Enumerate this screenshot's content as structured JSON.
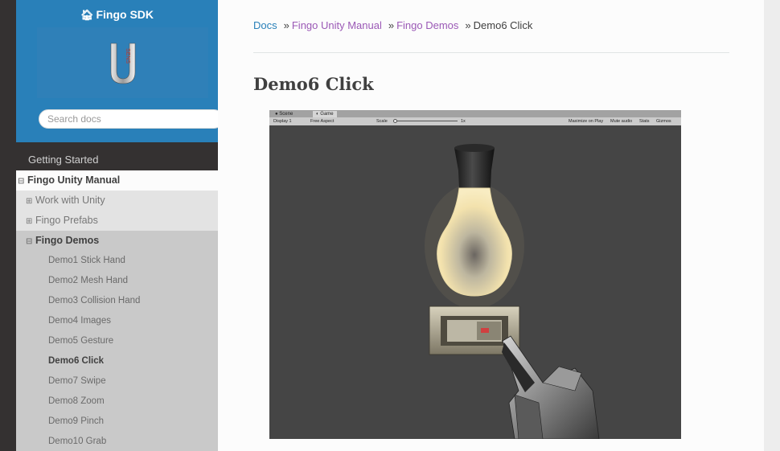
{
  "sidebar": {
    "brand": "Fingo SDK",
    "home_icon": "home-icon",
    "search_placeholder": "Search docs",
    "caption": "Getting Started",
    "items": [
      {
        "label": "Fingo Unity Manual",
        "toggle": "⊟"
      },
      {
        "label": "Work with Unity",
        "toggle": "⊞"
      },
      {
        "label": "Fingo Prefabs",
        "toggle": "⊞"
      },
      {
        "label": "Fingo Demos",
        "toggle": "⊟"
      },
      {
        "label": "Demo1 Stick Hand"
      },
      {
        "label": "Demo2 Mesh Hand"
      },
      {
        "label": "Demo3 Collision Hand"
      },
      {
        "label": "Demo4 Images"
      },
      {
        "label": "Demo5 Gesture"
      },
      {
        "label": "Demo6 Click"
      },
      {
        "label": "Demo7 Swipe"
      },
      {
        "label": "Demo8 Zoom"
      },
      {
        "label": "Demo9 Pinch"
      },
      {
        "label": "Demo10 Grab"
      }
    ]
  },
  "breadcrumb": {
    "docs": "Docs",
    "sep": "»",
    "manual": "Fingo Unity Manual",
    "demos": "Fingo Demos",
    "current": "Demo6 Click"
  },
  "page_title": "Demo6 Click",
  "unity": {
    "tabs": [
      "Scene",
      "Game"
    ],
    "display": "Display 1",
    "aspect": "Free Aspect",
    "scale_label": "Scale",
    "scale_value": "1x",
    "toolbar_right": [
      "Maximize on Play",
      "Mute audio",
      "Stats",
      "Gizmos"
    ]
  }
}
